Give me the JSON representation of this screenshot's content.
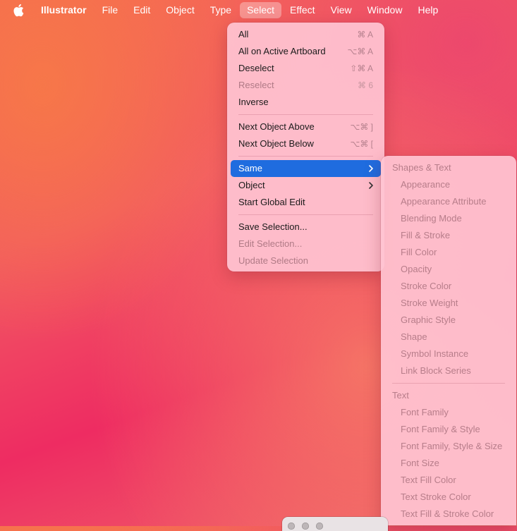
{
  "menubar": {
    "apple_icon": "apple-logo-icon",
    "app_name": "Illustrator",
    "items": [
      "File",
      "Edit",
      "Object",
      "Type",
      "Select",
      "Effect",
      "View",
      "Window",
      "Help"
    ],
    "active": "Select"
  },
  "select_menu": {
    "group1": [
      {
        "label": "All",
        "shortcut": "⌘ A",
        "enabled": true
      },
      {
        "label": "All on Active Artboard",
        "shortcut": "⌥⌘ A",
        "enabled": true
      },
      {
        "label": "Deselect",
        "shortcut": "⇧⌘ A",
        "enabled": true
      },
      {
        "label": "Reselect",
        "shortcut": "⌘ 6",
        "enabled": false
      },
      {
        "label": "Inverse",
        "shortcut": "",
        "enabled": true
      }
    ],
    "group2": [
      {
        "label": "Next Object Above",
        "shortcut": "⌥⌘ ]",
        "enabled": true
      },
      {
        "label": "Next Object Below",
        "shortcut": "⌥⌘ [",
        "enabled": true
      }
    ],
    "group3": [
      {
        "label": "Same",
        "has_submenu": true,
        "highlighted": true
      },
      {
        "label": "Object",
        "has_submenu": true
      },
      {
        "label": "Start Global Edit"
      }
    ],
    "group4": [
      {
        "label": "Save Selection...",
        "enabled": true
      },
      {
        "label": "Edit Selection...",
        "enabled": false
      },
      {
        "label": "Update Selection",
        "enabled": false
      }
    ]
  },
  "same_submenu": {
    "section1_header": "Shapes & Text",
    "section1_items": [
      "Appearance",
      "Appearance Attribute",
      "Blending Mode",
      "Fill & Stroke",
      "Fill Color",
      "Opacity",
      "Stroke Color",
      "Stroke Weight",
      "Graphic Style",
      "Shape",
      "Symbol Instance",
      "Link Block Series"
    ],
    "section2_header": "Text",
    "section2_items": [
      "Font Family",
      "Font Family & Style",
      "Font Family, Style & Size",
      "Font Size",
      "Text Fill Color",
      "Text Stroke Color",
      "Text Fill & Stroke Color"
    ]
  },
  "colors": {
    "highlight": "#1f6cdf",
    "menu_bg": "#ffc4d2",
    "disabled_text": "#b07a86"
  }
}
